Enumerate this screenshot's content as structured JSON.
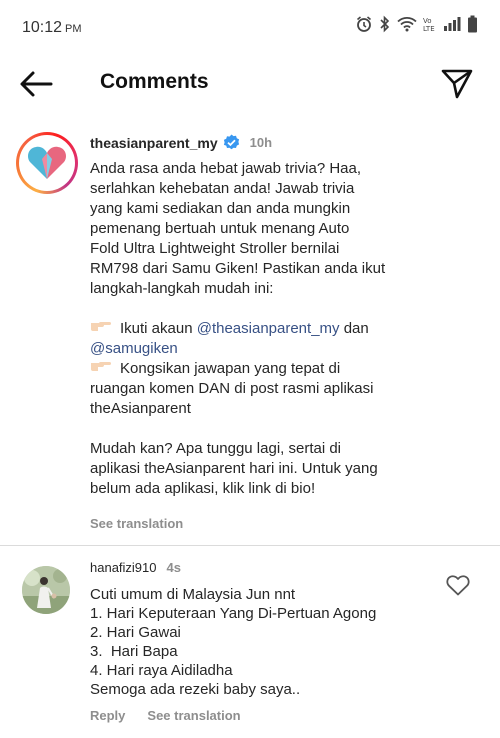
{
  "status_bar": {
    "time": "10:12",
    "ampm": "PM"
  },
  "header": {
    "title": "Comments"
  },
  "post": {
    "username": "theasianparent_my",
    "time": "10h",
    "caption_lines": [
      "Anda rasa anda hebat jawab trivia? Haa,",
      "serlahkan kehebatan anda! Jawab trivia",
      "yang kami sediakan dan anda mungkin",
      "pemenang bertuah untuk menang Auto",
      "Fold Ultra Lightweight Stroller bernilai",
      "RM798 dari Samu Giken! Pastikan anda ikut",
      "langkah-langkah mudah ini:"
    ],
    "step1_prefix": "Ikuti akaun ",
    "mention1": "@theasianparent_my",
    "step1_mid": " dan",
    "mention2": "@samugiken",
    "step2_line1": "Kongsikan jawapan yang tepat di",
    "step2_line2": "ruangan komen DAN di post rasmi aplikasi",
    "step2_line3": "theAsianparent",
    "closing_lines": [
      "Mudah kan? Apa tunggu lagi, sertai di",
      "aplikasi theAsianparent hari ini. Untuk yang",
      "belum ada aplikasi, klik link di bio!"
    ],
    "see_translation": "See translation"
  },
  "comment": {
    "username": "hanafizi910",
    "time": "4s",
    "lines": [
      "Cuti umum di Malaysia Jun nnt",
      "1. Hari Keputeraan Yang Di-Pertuan Agong",
      "2. Hari Gawai",
      "3.  Hari Bapa",
      "4. Hari raya Aidiladha",
      "Semoga ada rezeki baby saya.."
    ],
    "reply": "Reply",
    "see_translation": "See translation"
  },
  "colors": {
    "verified": "#3897f0",
    "mention": "#385185",
    "muted": "#8e8e8e"
  },
  "icons": {
    "back": "arrow-left-icon",
    "send": "paper-plane-icon",
    "like": "heart-outline-icon",
    "hand": "pointing-hand-emoji"
  }
}
